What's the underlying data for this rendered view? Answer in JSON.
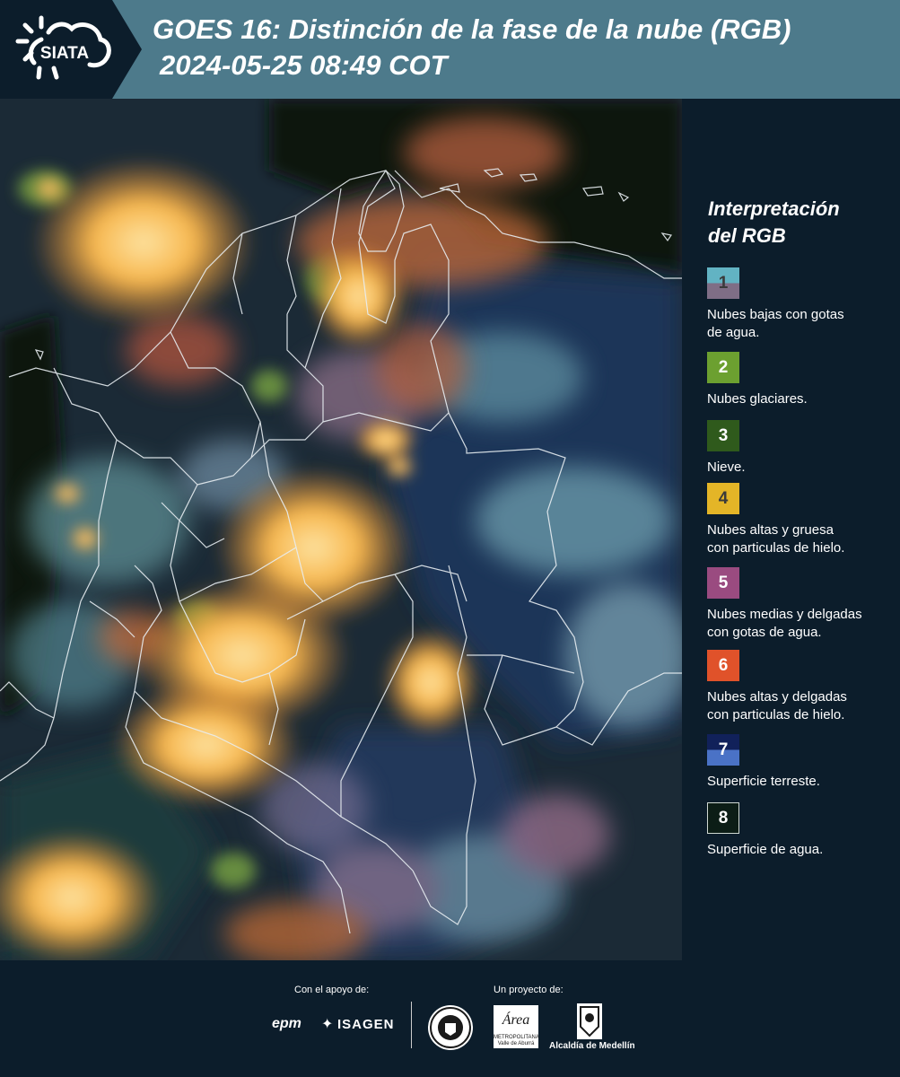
{
  "header": {
    "logo_text": "SIATA",
    "title": "GOES 16: Distinción de la fase de la nube (RGB)",
    "subtitle": "2024-05-25 08:49 COT"
  },
  "legend": {
    "title_line1": "Interpretación",
    "title_line2": "del RGB",
    "items": [
      {
        "number": "1",
        "label_line1": "Nubes bajas con gotas",
        "label_line2": "de agua.",
        "color_top": "#62b3c3",
        "color_bottom": "#7f6e86",
        "text_color": "#3a3a3a"
      },
      {
        "number": "2",
        "label_line1": "Nubes glaciares.",
        "label_line2": "",
        "color_top": "#6ca030",
        "color_bottom": "#6ca030",
        "text_color": "#ffffff"
      },
      {
        "number": "3",
        "label_line1": "Nieve.",
        "label_line2": "",
        "color_top": "#2f5a1c",
        "color_bottom": "#2f5a1c",
        "text_color": "#ffffff"
      },
      {
        "number": "4",
        "label_line1": "Nubes altas y gruesa",
        "label_line2": "con particulas de hielo.",
        "color_top": "#e4b527",
        "color_bottom": "#e4b527",
        "text_color": "#3a3a3a"
      },
      {
        "number": "5",
        "label_line1": "Nubes medias y delgadas",
        "label_line2": "con gotas de agua.",
        "color_top": "#9a4b80",
        "color_bottom": "#9a4b80",
        "text_color": "#ffffff"
      },
      {
        "number": "6",
        "label_line1": "Nubes altas y delgadas",
        "label_line2": "con particulas de hielo.",
        "color_top": "#e0522a",
        "color_bottom": "#e0522a",
        "text_color": "#ffffff"
      },
      {
        "number": "7",
        "label_line1": "Superficie terreste.",
        "label_line2": "",
        "color_top": "#11215a",
        "color_bottom": "#4a72c6",
        "text_color": "#ffffff"
      },
      {
        "number": "8",
        "label_line1": "Superficie de agua.",
        "label_line2": "",
        "color_top": "#0c1d16",
        "color_bottom": "#0c1d16",
        "text_color": "#ffffff"
      }
    ]
  },
  "footer": {
    "support_label": "Con el apoyo de:",
    "project_label": "Un proyecto de:",
    "sponsor_epm": "epm",
    "sponsor_isagen": "ISAGEN",
    "area_logo_text": "Área",
    "area_logo_subtext": "METROPOLITANA Valle de Aburrá",
    "medellin_text": "Alcaldía de Medellín"
  },
  "colors": {
    "background": "#0c1d2b",
    "header_band": "#4d7a8b",
    "cloud_thick": "#f6a83c",
    "ocean": "#0a1a12"
  },
  "icons": [
    "siata-sun-cloud-logo",
    "medellin-seal-icon",
    "area-metropolitana-logo",
    "alcaldia-medellin-logo"
  ]
}
